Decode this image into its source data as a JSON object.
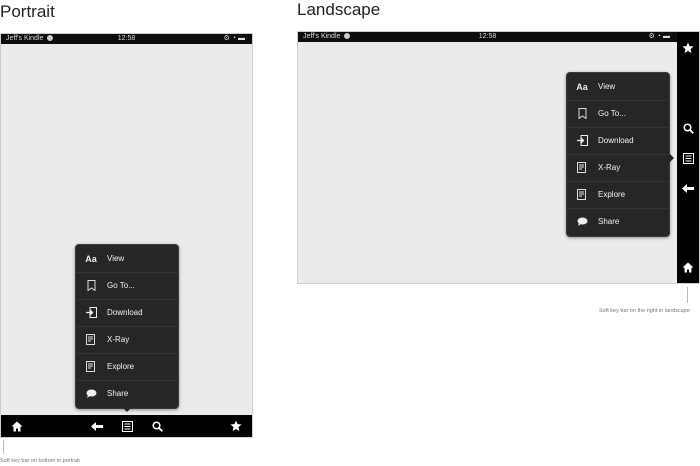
{
  "portrait": {
    "heading": "Portrait",
    "status": {
      "device_name": "Jeff's Kindle",
      "time": "12:58"
    },
    "menu": [
      {
        "label": "View",
        "icon": "font-size-icon"
      },
      {
        "label": "Go To...",
        "icon": "bookmark-icon"
      },
      {
        "label": "Download",
        "icon": "download-icon"
      },
      {
        "label": "X-Ray",
        "icon": "xray-icon"
      },
      {
        "label": "Explore",
        "icon": "explore-icon"
      },
      {
        "label": "Share",
        "icon": "share-icon"
      }
    ],
    "softkeys": [
      "home-icon",
      "back-icon",
      "menu-icon",
      "search-icon",
      "favorites-icon"
    ],
    "caption": "Soft key bar on bottom in portrait"
  },
  "landscape": {
    "heading": "Landscape",
    "status": {
      "device_name": "Jeff's Kindle",
      "time": "12:58"
    },
    "menu": [
      {
        "label": "View",
        "icon": "font-size-icon"
      },
      {
        "label": "Go To...",
        "icon": "bookmark-icon"
      },
      {
        "label": "Download",
        "icon": "download-icon"
      },
      {
        "label": "X-Ray",
        "icon": "xray-icon"
      },
      {
        "label": "Explore",
        "icon": "explore-icon"
      },
      {
        "label": "Share",
        "icon": "share-icon"
      }
    ],
    "softkeys": [
      "favorites-icon",
      "search-icon",
      "menu-icon",
      "back-icon",
      "home-icon"
    ],
    "caption": "Soft key bar on the right in landscape"
  },
  "icons": {
    "view_glyph": "Aa"
  },
  "colors": {
    "menu_bg": "#262626",
    "softbar": "#000000",
    "screen": "#ebebec"
  }
}
